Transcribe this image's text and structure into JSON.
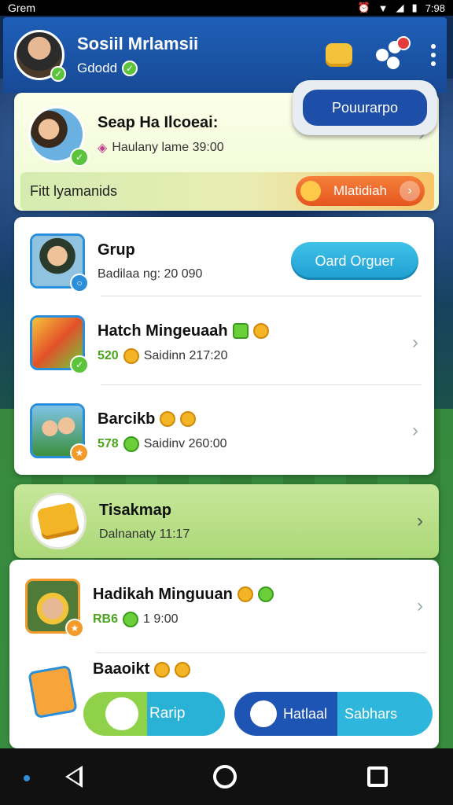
{
  "status_bar": {
    "carrier": "Grem",
    "time": "7:98"
  },
  "header": {
    "title": "Sosiil Mrlamsii",
    "subtitle": "Gdodd"
  },
  "top_card": {
    "title": "Seap Ha Ilcoeai:",
    "subtitle": "Haulany lame 39:00"
  },
  "popup_button": {
    "label": "Pouurarpo"
  },
  "banner": {
    "label": "Fitt lyamanids",
    "button_label": "Mlatidiah"
  },
  "list": [
    {
      "title": "Grup",
      "subtitle": "Badilaa ng: 20 090",
      "button": "Oard Orguer"
    },
    {
      "title": "Hatch Mingeuaah",
      "amount": "520",
      "subtitle": "Saidinn 217:20"
    },
    {
      "title": "Barcikb",
      "amount": "578",
      "subtitle": "Saidinv 260:00"
    }
  ],
  "section": {
    "title": "Tisakmap",
    "subtitle": "Dalnanaty 11:17"
  },
  "bottom_list": [
    {
      "title": "Hadikah Minguuan",
      "amount": "RB6",
      "subtitle": "1 9:00"
    },
    {
      "title": "Baaoikt"
    }
  ],
  "bottom_buttons": {
    "ramp_label": "Rarip",
    "hatal_label": "Hatlaal",
    "sabhars_label": "Sabhars"
  },
  "colors": {
    "header_blue": "#1f5fb8",
    "accent_green": "#5cc43c",
    "accent_orange": "#e5561f",
    "accent_cyan": "#2fb6dc"
  }
}
